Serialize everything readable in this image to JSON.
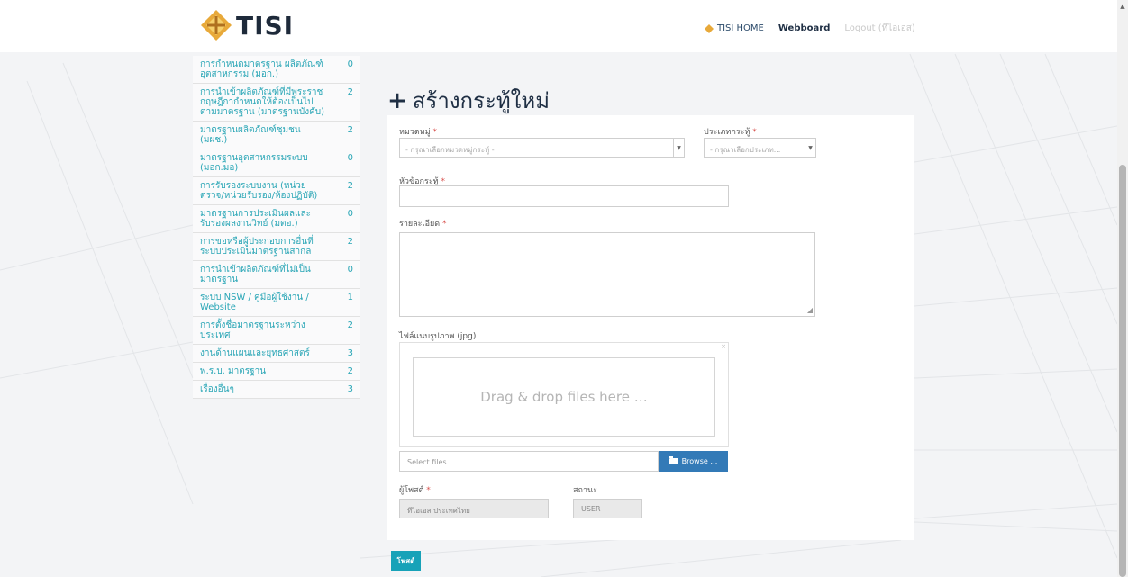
{
  "header": {
    "logo_text": "TISI",
    "nav": {
      "home": "TISI HOME",
      "webboard": "Webboard",
      "logout": "Logout (ทีไอเอส)"
    }
  },
  "sidebar": {
    "items": [
      {
        "label": "การกำหนดมาตรฐาน ผลิตภัณฑ์อุตสาหกรรม (มอก.)",
        "count": "0"
      },
      {
        "label": "การนำเข้าผลิตภัณฑ์ที่มีพระราชกฤษฎีกากำหนดให้ต้องเป็นไปตามมาตรฐาน (มาตรฐานบังคับ)",
        "count": "2"
      },
      {
        "label": "มาตรฐานผลิตภัณฑ์ชุมชน (มผช.)",
        "count": "2"
      },
      {
        "label": "มาตรฐานอุตสาหกรรมระบบ (มอก.มอ)",
        "count": "0"
      },
      {
        "label": "การรับรองระบบงาน (หน่วยตรวจ/หน่วยรับรอง/ห้องปฏิบัติ)",
        "count": "2"
      },
      {
        "label": "มาตรฐานการประเมินผลและรับรองผลงานวิทย์ (มตอ.)",
        "count": "0"
      },
      {
        "label": "การขอหรือผู้ประกอบการอื่นที่ระบบประเมินมาตรฐานสากล",
        "count": "2"
      },
      {
        "label": "การนำเข้าผลิตภัณฑ์ที่ไม่เป็นมาตรฐาน",
        "count": "0"
      },
      {
        "label": "ระบบ NSW / คู่มือผู้ใช้งาน / Website",
        "count": "1"
      },
      {
        "label": "การตั้งชื่อมาตรฐานระหว่างประเทศ",
        "count": "2"
      },
      {
        "label": "งานด้านแผนและยุทธศาสตร์",
        "count": "3"
      },
      {
        "label": "พ.ร.บ. มาตรฐาน",
        "count": "2"
      },
      {
        "label": "เรื่องอื่นๆ",
        "count": "3"
      }
    ]
  },
  "page": {
    "title": "สร้างกระทู้ใหม่"
  },
  "form": {
    "category": {
      "label": "หมวดหมู่",
      "placeholder": "- กรุณาเลือกหมวดหมู่กระทู้ -"
    },
    "type": {
      "label": "ประเภทกระทู้",
      "placeholder": "- กรุณาเลือกประเภท..."
    },
    "topic": {
      "label": "หัวข้อกระทู้",
      "value": ""
    },
    "detail": {
      "label": "รายละเอียด",
      "value": ""
    },
    "attachment": {
      "label": "ไฟล์แนบรูปภาพ (jpg)",
      "dropzone_text": "Drag & drop files here …",
      "caption_placeholder": "Select files...",
      "browse_label": "Browse …"
    },
    "poster": {
      "label": "ผู้โพสต์",
      "value": "ทีไอเอส ประเทศไทย"
    },
    "status": {
      "label": "สถานะ",
      "value": "USER"
    },
    "required_mark": "*",
    "submit_label": "โพสต์"
  },
  "colors": {
    "accent": "#2aa6b6",
    "submit": "#17a2b8",
    "browse": "#337ab7",
    "title": "#1f2f44"
  }
}
